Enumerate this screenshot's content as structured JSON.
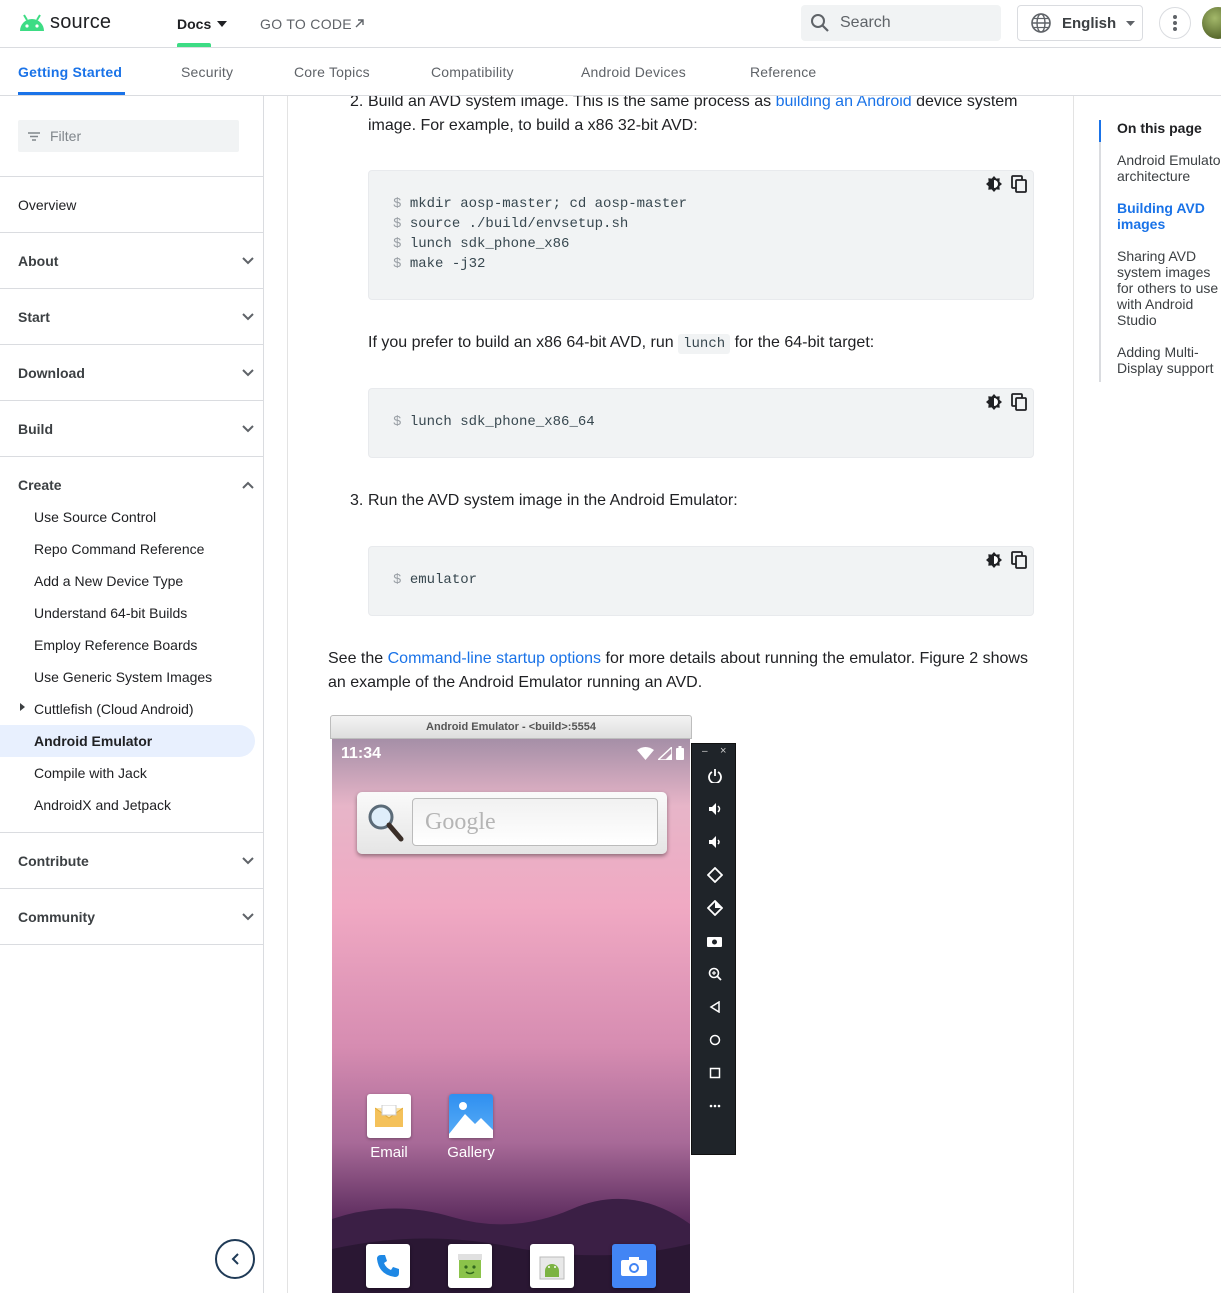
{
  "header": {
    "logo_text": "source",
    "docs_label": "Docs",
    "go_to_code_label": "GO TO CODE",
    "search_placeholder": "Search",
    "language_label": "English"
  },
  "tabs": [
    {
      "label": "Getting Started",
      "active": true
    },
    {
      "label": "Security"
    },
    {
      "label": "Core Topics"
    },
    {
      "label": "Compatibility"
    },
    {
      "label": "Android Devices"
    },
    {
      "label": "Reference"
    }
  ],
  "sidebar": {
    "filter_placeholder": "Filter",
    "overview": "Overview",
    "sections": [
      "About",
      "Start",
      "Download",
      "Build",
      "Create",
      "Contribute",
      "Community"
    ],
    "create_items": [
      "Use Source Control",
      "Repo Command Reference",
      "Add a New Device Type",
      "Understand 64-bit Builds",
      "Employ Reference Boards",
      "Use Generic System Images",
      "Cuttlefish (Cloud Android)",
      "Android Emulator",
      "Compile with Jack",
      "AndroidX and Jetpack"
    ],
    "active_item": "Android Emulator"
  },
  "content": {
    "step2_num": "2.",
    "step2_a": "Build an AVD system image. This is the same process as ",
    "step2_link": "building an Android",
    "step2_b": " device system",
    "step2_c": "image. For example, to build a x86 32-bit AVD:",
    "code1": [
      {
        "prompt": "$",
        "cmd": "mkdir aosp-master; cd aosp-master"
      },
      {
        "prompt": "$",
        "cmd": "source ./build/envsetup.sh"
      },
      {
        "prompt": "$",
        "cmd": "lunch sdk_phone_x86"
      },
      {
        "prompt": "$",
        "cmd": "make -j32"
      }
    ],
    "para64_a": "If you prefer to build an x86 64-bit AVD, run ",
    "para64_code": "lunch",
    "para64_b": " for the 64-bit target:",
    "code2": {
      "prompt": "$",
      "cmd": "lunch sdk_phone_x86_64"
    },
    "step3_num": "3.",
    "step3": "Run the AVD system image in the Android Emulator:",
    "code3": {
      "prompt": "$",
      "cmd": "emulator"
    },
    "see_a": "See the ",
    "see_link": "Command-line startup options",
    "see_b": " for more details about running the emulator. Figure 2 shows",
    "see_c": "an example of the Android Emulator running an AVD."
  },
  "emulator": {
    "title": "Android Emulator - <build>:5554",
    "time": "11:34",
    "search_logo": "Google",
    "apps": [
      "Email",
      "Gallery"
    ],
    "controls": [
      "power-icon",
      "volume-up-icon",
      "volume-down-icon",
      "rotate-left-icon",
      "rotate-right-icon",
      "camera-icon",
      "zoom-icon",
      "back-icon",
      "home-icon",
      "overview-icon",
      "more-icon"
    ]
  },
  "toc": {
    "title": "On this page",
    "items": [
      {
        "label": "Android Emulator architecture"
      },
      {
        "label": "Building AVD images",
        "active": true
      },
      {
        "label": "Sharing AVD system images for others to use with Android Studio"
      },
      {
        "label": "Adding Multi-Display support"
      }
    ]
  },
  "colors": {
    "accent": "#1a73e8",
    "android_green": "#3ddc84",
    "active_bg": "#e8f0fe"
  }
}
